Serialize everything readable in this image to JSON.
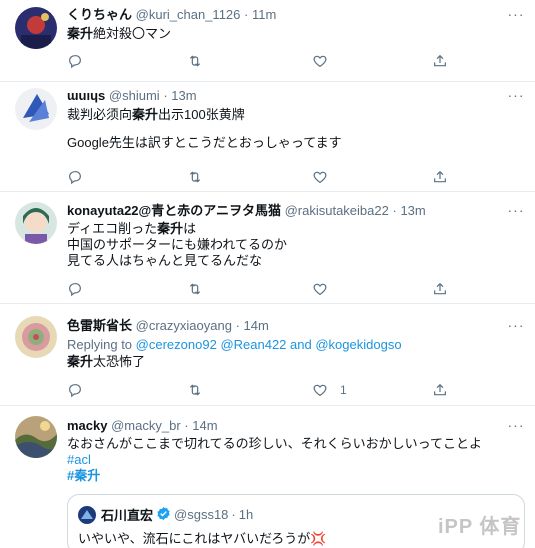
{
  "tweets": [
    {
      "name": "くりちゃん",
      "handle": "@kuri_chan_1126",
      "dot": "·",
      "time": "11m",
      "lines": [
        [
          "秦升",
          "絶対殺〇マン"
        ]
      ],
      "reply": "",
      "retweet": "",
      "like": ""
    },
    {
      "name": "ɯuıɥs",
      "handle": "@shiumi",
      "dot": "·",
      "time": "13m",
      "lines": [
        [
          "裁判必须向",
          "秦升",
          "出示100张黄牌"
        ],
        [
          "",
          "",
          ""
        ],
        [
          "Google先生は訳すとこうだとおっしゃってます",
          "",
          ""
        ]
      ],
      "reply": "",
      "retweet": "",
      "like": ""
    },
    {
      "name": "konayuta22@青と赤のアニヲタ馬猫",
      "handle": "@rakisutakeiba22",
      "dot": "·",
      "time": "13m",
      "lines": [
        [
          "ディエコ削った",
          "秦升",
          "は"
        ],
        [
          "中国のサポーターにも嫌われてるのか",
          "",
          ""
        ],
        [
          "見てる人はちゃんと見てるんだな",
          "",
          ""
        ]
      ],
      "reply": "",
      "retweet": "",
      "like": ""
    },
    {
      "name": "色雷斯省长",
      "handle": "@crazyxiaoyang",
      "dot": "·",
      "time": "14m",
      "replying": "Replying to",
      "mentions": [
        "@cerezono92",
        "@Rean422",
        "and",
        "@kogekidogso"
      ],
      "lines": [
        [
          "秦升",
          "太恐怖了",
          ""
        ]
      ],
      "reply": "",
      "retweet": "",
      "like": "1"
    },
    {
      "name": "macky",
      "handle": "@macky_br",
      "dot": "·",
      "time": "14m",
      "lines": [
        [
          "なおさんがここまで切れてるの珍しい、それくらいおかしいってことよ",
          "",
          ""
        ]
      ],
      "hashtags": [
        "#acl",
        "#秦升"
      ],
      "quote": {
        "name": "石川直宏",
        "handle": "@sgss18",
        "dot": "·",
        "time": "1h",
        "text": "いやいや、流石にこれはヤバいだろうが💢"
      }
    }
  ],
  "icons": {
    "more": "more-icon",
    "reply": "reply-icon",
    "retweet": "retweet-icon",
    "like": "heart-icon",
    "share": "share-icon",
    "verified": "verified-badge-icon"
  },
  "colors": {
    "text": "#0f1419",
    "secondary": "#5b7083",
    "link": "#1b95e0",
    "divider": "#e6ecf0",
    "verified": "#1da1f2"
  },
  "watermark": "iPP 体育"
}
